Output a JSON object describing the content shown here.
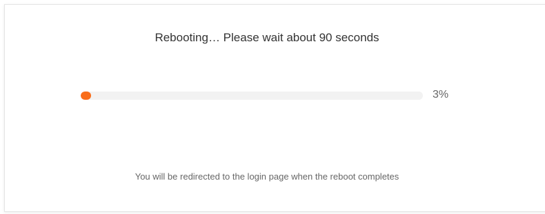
{
  "dialog": {
    "title": "Rebooting… Please wait about 90 seconds",
    "progress": {
      "percent_label": "3%",
      "fraction": 0.03,
      "fill_color": "#f96d1a",
      "track_color": "#f2f2f2"
    },
    "note": "You will be redirected to the login page when the reboot completes"
  }
}
